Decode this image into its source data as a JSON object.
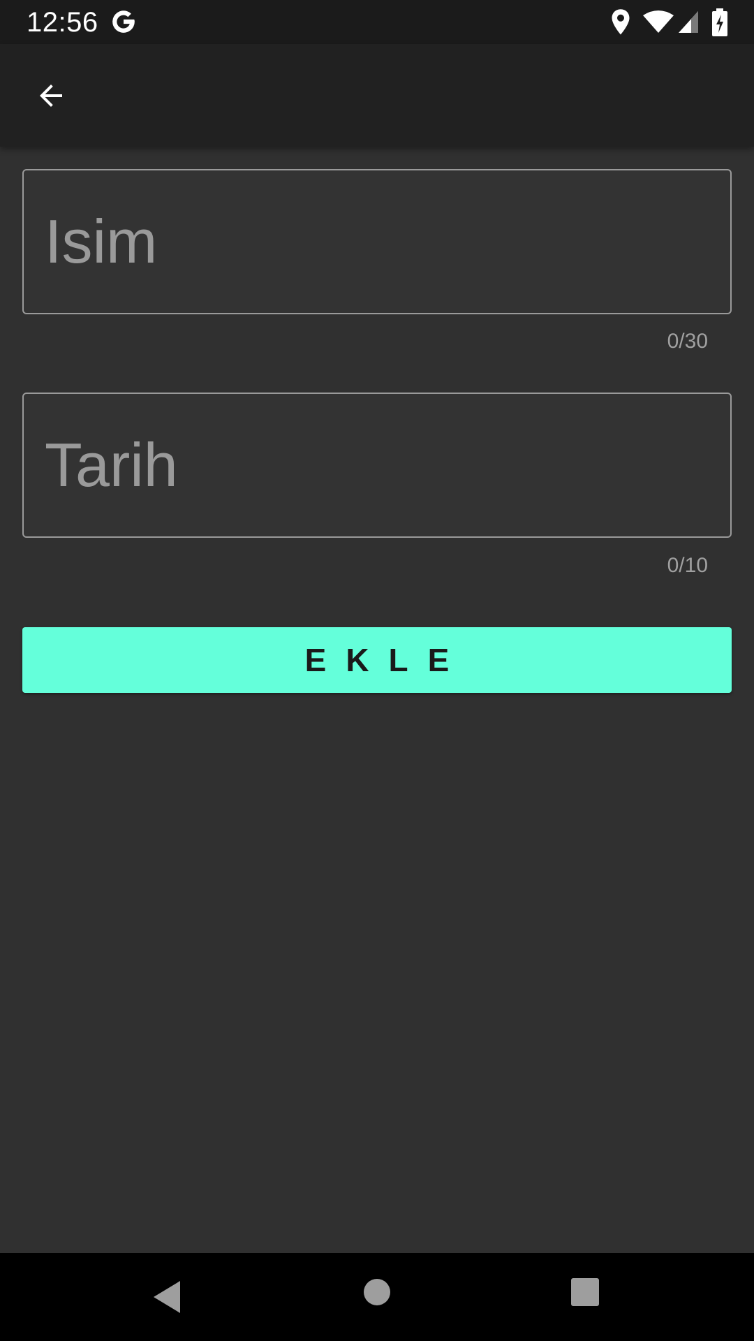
{
  "status_bar": {
    "time": "12:56",
    "icons": [
      "google-g-icon",
      "location-icon",
      "wifi-icon",
      "cell-signal-icon",
      "battery-charging-icon"
    ]
  },
  "app_bar": {
    "back_icon": "arrow-back-icon"
  },
  "form": {
    "name_field": {
      "placeholder": "Isim",
      "value": "",
      "counter": "0/30"
    },
    "date_field": {
      "placeholder": "Tarih",
      "value": "",
      "counter": "0/10"
    },
    "add_button_label": "EKLE"
  },
  "nav_bar": {
    "icons": [
      "nav-back-icon",
      "nav-home-icon",
      "nav-recents-icon"
    ]
  },
  "colors": {
    "background": "#303030",
    "app_bar": "#212121",
    "accent": "#64ffda"
  }
}
